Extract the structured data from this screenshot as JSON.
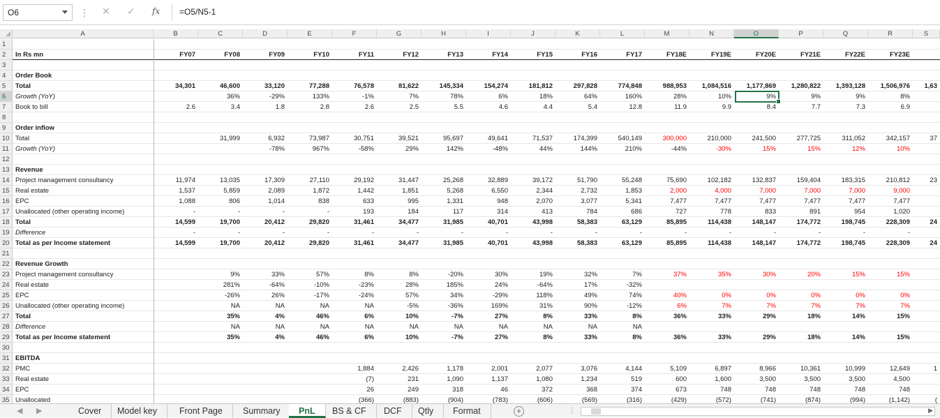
{
  "name_box": "O6",
  "formula_icons": {
    "cancel": "✕",
    "enter": "✓",
    "fx": "fx"
  },
  "formula": "=O5/N5-1",
  "columns": [
    "A",
    "B",
    "C",
    "D",
    "E",
    "F",
    "G",
    "H",
    "I",
    "J",
    "K",
    "L",
    "M",
    "N",
    "O",
    "P",
    "Q",
    "R",
    "S"
  ],
  "row_numbers": [
    "1",
    "2",
    "3",
    "4",
    "5",
    "6",
    "7",
    "8",
    "9",
    "10",
    "11",
    "12",
    "13",
    "14",
    "15",
    "16",
    "17",
    "18",
    "19",
    "20",
    "21",
    "22",
    "23",
    "24",
    "25",
    "26",
    "27",
    "28",
    "29",
    "30",
    "31",
    "32",
    "33",
    "34",
    "35"
  ],
  "years": [
    "FY07",
    "FY08",
    "FY09",
    "FY10",
    "FY11",
    "FY12",
    "FY13",
    "FY14",
    "FY15",
    "FY16",
    "FY17",
    "FY18E",
    "FY19E",
    "FY20E",
    "FY21E",
    "FY22E",
    "FY23E"
  ],
  "rows": [
    {
      "r": 1,
      "label": "",
      "vals": []
    },
    {
      "r": 2,
      "label": "In Rs mn",
      "style": "b hdr",
      "vals": []
    },
    {
      "r": 3,
      "label": "",
      "vals": []
    },
    {
      "r": 4,
      "label": "Order Book",
      "style": "b",
      "vals": []
    },
    {
      "r": 5,
      "label": "Total",
      "style": "b",
      "vals": [
        "34,301",
        "46,600",
        "33,120",
        "77,288",
        "76,578",
        "81,622",
        "145,334",
        "154,274",
        "181,812",
        "297,828",
        "774,848",
        "988,953",
        "1,084,516",
        "1,177,869",
        "1,280,822",
        "1,393,128",
        "1,506,976",
        "1,63"
      ]
    },
    {
      "r": 6,
      "label": "Growth (YoY)",
      "style": "i",
      "vals": [
        "",
        "36%",
        "-29%",
        "133%",
        "-1%",
        "7%",
        "78%",
        "6%",
        "18%",
        "64%",
        "160%",
        "28%",
        "10%",
        "9%",
        "9%",
        "9%",
        "8%",
        ""
      ]
    },
    {
      "r": 7,
      "label": "Book to bill",
      "vals": [
        "2.6",
        "3.4",
        "1.8",
        "2.8",
        "2.6",
        "2.5",
        "5.5",
        "4.6",
        "4.4",
        "5.4",
        "12.8",
        "11.9",
        "9.9",
        "8.4",
        "7.7",
        "7.3",
        "6.9",
        ""
      ]
    },
    {
      "r": 8,
      "label": "",
      "vals": []
    },
    {
      "r": 9,
      "label": "Order inflow",
      "style": "b",
      "vals": []
    },
    {
      "r": 10,
      "label": "Total",
      "vals": [
        "",
        "31,999",
        "6,932",
        "73,987",
        "30,751",
        "39,521",
        "95,697",
        "49,641",
        "71,537",
        "174,399",
        "540,149",
        "300,000",
        "210,000",
        "241,500",
        "277,725",
        "311,052",
        "342,157",
        "37"
      ],
      "red": [
        11
      ]
    },
    {
      "r": 11,
      "label": "Growth (YoY)",
      "style": "i",
      "vals": [
        "",
        "",
        "-78%",
        "967%",
        "-58%",
        "29%",
        "142%",
        "-48%",
        "44%",
        "144%",
        "210%",
        "-44%",
        "-30%",
        "15%",
        "15%",
        "12%",
        "10%",
        ""
      ],
      "red": [
        12,
        13,
        14,
        15,
        16
      ]
    },
    {
      "r": 12,
      "label": "",
      "vals": []
    },
    {
      "r": 13,
      "label": "Revenue",
      "style": "b",
      "vals": []
    },
    {
      "r": 14,
      "label": "Project management consultancy",
      "vals": [
        "11,974",
        "13,035",
        "17,309",
        "27,110",
        "29,192",
        "31,447",
        "25,268",
        "32,889",
        "39,172",
        "51,790",
        "55,248",
        "75,690",
        "102,182",
        "132,837",
        "159,404",
        "183,315",
        "210,812",
        "23"
      ]
    },
    {
      "r": 15,
      "label": "Real estate",
      "vals": [
        "1,537",
        "5,859",
        "2,089",
        "1,872",
        "1,442",
        "1,851",
        "5,268",
        "6,550",
        "2,344",
        "2,732",
        "1,853",
        "2,000",
        "4,000",
        "7,000",
        "7,000",
        "7,000",
        "9,000",
        ""
      ],
      "red": [
        11,
        12,
        13,
        14,
        15,
        16
      ]
    },
    {
      "r": 16,
      "label": "EPC",
      "vals": [
        "1,088",
        "806",
        "1,014",
        "838",
        "633",
        "995",
        "1,331",
        "948",
        "2,070",
        "3,077",
        "5,341",
        "7,477",
        "7,477",
        "7,477",
        "7,477",
        "7,477",
        "7,477",
        ""
      ]
    },
    {
      "r": 17,
      "label": "Unallocated (other operating income)",
      "vals": [
        "-",
        "-",
        "-",
        "-",
        "193",
        "184",
        "117",
        "314",
        "413",
        "784",
        "686",
        "727",
        "778",
        "833",
        "891",
        "954",
        "1,020",
        ""
      ]
    },
    {
      "r": 18,
      "label": "Total",
      "style": "b",
      "vals": [
        "14,599",
        "19,700",
        "20,412",
        "29,820",
        "31,461",
        "34,477",
        "31,985",
        "40,701",
        "43,998",
        "58,383",
        "63,129",
        "85,895",
        "114,438",
        "148,147",
        "174,772",
        "198,745",
        "228,309",
        "24"
      ]
    },
    {
      "r": 19,
      "label": "Difference",
      "style": "i",
      "vals": [
        "-",
        "-",
        "-",
        "-",
        "-",
        "-",
        "-",
        "-",
        "-",
        "-",
        "-",
        "-",
        "-",
        "-",
        "-",
        "-",
        "-",
        ""
      ]
    },
    {
      "r": 20,
      "label": "Total as per Income statement",
      "style": "b",
      "vals": [
        "14,599",
        "19,700",
        "20,412",
        "29,820",
        "31,461",
        "34,477",
        "31,985",
        "40,701",
        "43,998",
        "58,383",
        "63,129",
        "85,895",
        "114,438",
        "148,147",
        "174,772",
        "198,745",
        "228,309",
        "24"
      ]
    },
    {
      "r": 21,
      "label": "",
      "vals": []
    },
    {
      "r": 22,
      "label": "Revenue Growth",
      "style": "b",
      "vals": []
    },
    {
      "r": 23,
      "label": "Project management consultancy",
      "vals": [
        "",
        "9%",
        "33%",
        "57%",
        "8%",
        "8%",
        "-20%",
        "30%",
        "19%",
        "32%",
        "7%",
        "37%",
        "35%",
        "30%",
        "20%",
        "15%",
        "15%",
        ""
      ],
      "red": [
        11,
        12,
        13,
        14,
        15,
        16
      ]
    },
    {
      "r": 24,
      "label": "Real estate",
      "vals": [
        "",
        "281%",
        "-64%",
        "-10%",
        "-23%",
        "28%",
        "185%",
        "24%",
        "-64%",
        "17%",
        "-32%",
        "",
        "",
        "",
        "",
        "",
        "",
        ""
      ]
    },
    {
      "r": 25,
      "label": "EPC",
      "vals": [
        "",
        "-26%",
        "26%",
        "-17%",
        "-24%",
        "57%",
        "34%",
        "-29%",
        "118%",
        "49%",
        "74%",
        "40%",
        "0%",
        "0%",
        "0%",
        "0%",
        "0%",
        ""
      ],
      "red": [
        11,
        12,
        13,
        14,
        15,
        16
      ]
    },
    {
      "r": 26,
      "label": "Unallocated (other operating income)",
      "vals": [
        "",
        "NA",
        "NA",
        "NA",
        "NA",
        "-5%",
        "-36%",
        "169%",
        "31%",
        "90%",
        "-12%",
        "6%",
        "7%",
        "7%",
        "7%",
        "7%",
        "7%",
        ""
      ],
      "red": [
        11,
        12,
        13,
        14,
        15,
        16
      ]
    },
    {
      "r": 27,
      "label": "Total",
      "style": "b",
      "vals": [
        "",
        "35%",
        "4%",
        "46%",
        "6%",
        "10%",
        "-7%",
        "27%",
        "8%",
        "33%",
        "8%",
        "36%",
        "33%",
        "29%",
        "18%",
        "14%",
        "15%",
        ""
      ]
    },
    {
      "r": 28,
      "label": "Difference",
      "style": "i",
      "vals": [
        "",
        "NA",
        "NA",
        "NA",
        "NA",
        "NA",
        "NA",
        "NA",
        "NA",
        "NA",
        "NA",
        "",
        "",
        "",
        "",
        "",
        "",
        ""
      ]
    },
    {
      "r": 29,
      "label": "Total as per Income statement",
      "style": "b",
      "vals": [
        "",
        "35%",
        "4%",
        "46%",
        "6%",
        "10%",
        "-7%",
        "27%",
        "8%",
        "33%",
        "8%",
        "36%",
        "33%",
        "29%",
        "18%",
        "14%",
        "15%",
        ""
      ]
    },
    {
      "r": 30,
      "label": "",
      "vals": []
    },
    {
      "r": 31,
      "label": "EBITDA",
      "style": "b",
      "vals": []
    },
    {
      "r": 32,
      "label": "PMC",
      "vals": [
        "",
        "",
        "",
        "",
        "1,884",
        "2,426",
        "1,178",
        "2,001",
        "2,077",
        "3,076",
        "4,144",
        "5,109",
        "6,897",
        "8,966",
        "10,361",
        "10,999",
        "12,649",
        "1"
      ]
    },
    {
      "r": 33,
      "label": "Real estate",
      "vals": [
        "",
        "",
        "",
        "",
        "(7)",
        "231",
        "1,090",
        "1,137",
        "1,080",
        "1,234",
        "519",
        "600",
        "1,600",
        "3,500",
        "3,500",
        "3,500",
        "4,500",
        ""
      ]
    },
    {
      "r": 34,
      "label": "EPC",
      "vals": [
        "",
        "",
        "",
        "",
        "26",
        "249",
        "318",
        "46",
        "372",
        "368",
        "374",
        "673",
        "748",
        "748",
        "748",
        "748",
        "748",
        ""
      ]
    },
    {
      "r": 35,
      "label": "Unallocated",
      "vals": [
        "",
        "",
        "",
        "",
        "(366)",
        "(883)",
        "(904)",
        "(783)",
        "(606)",
        "(569)",
        "(316)",
        "(429)",
        "(572)",
        "(741)",
        "(874)",
        "(994)",
        "(1,142)",
        "("
      ]
    }
  ],
  "tabs": [
    "Cover",
    "Model key",
    "Front Page",
    "Summary",
    "PnL",
    "BS & CF",
    "DCF",
    "Qtly",
    "Format"
  ],
  "active_tab": "PnL",
  "colors": {
    "accent": "#217346",
    "forecast_red": "#ff0000"
  }
}
